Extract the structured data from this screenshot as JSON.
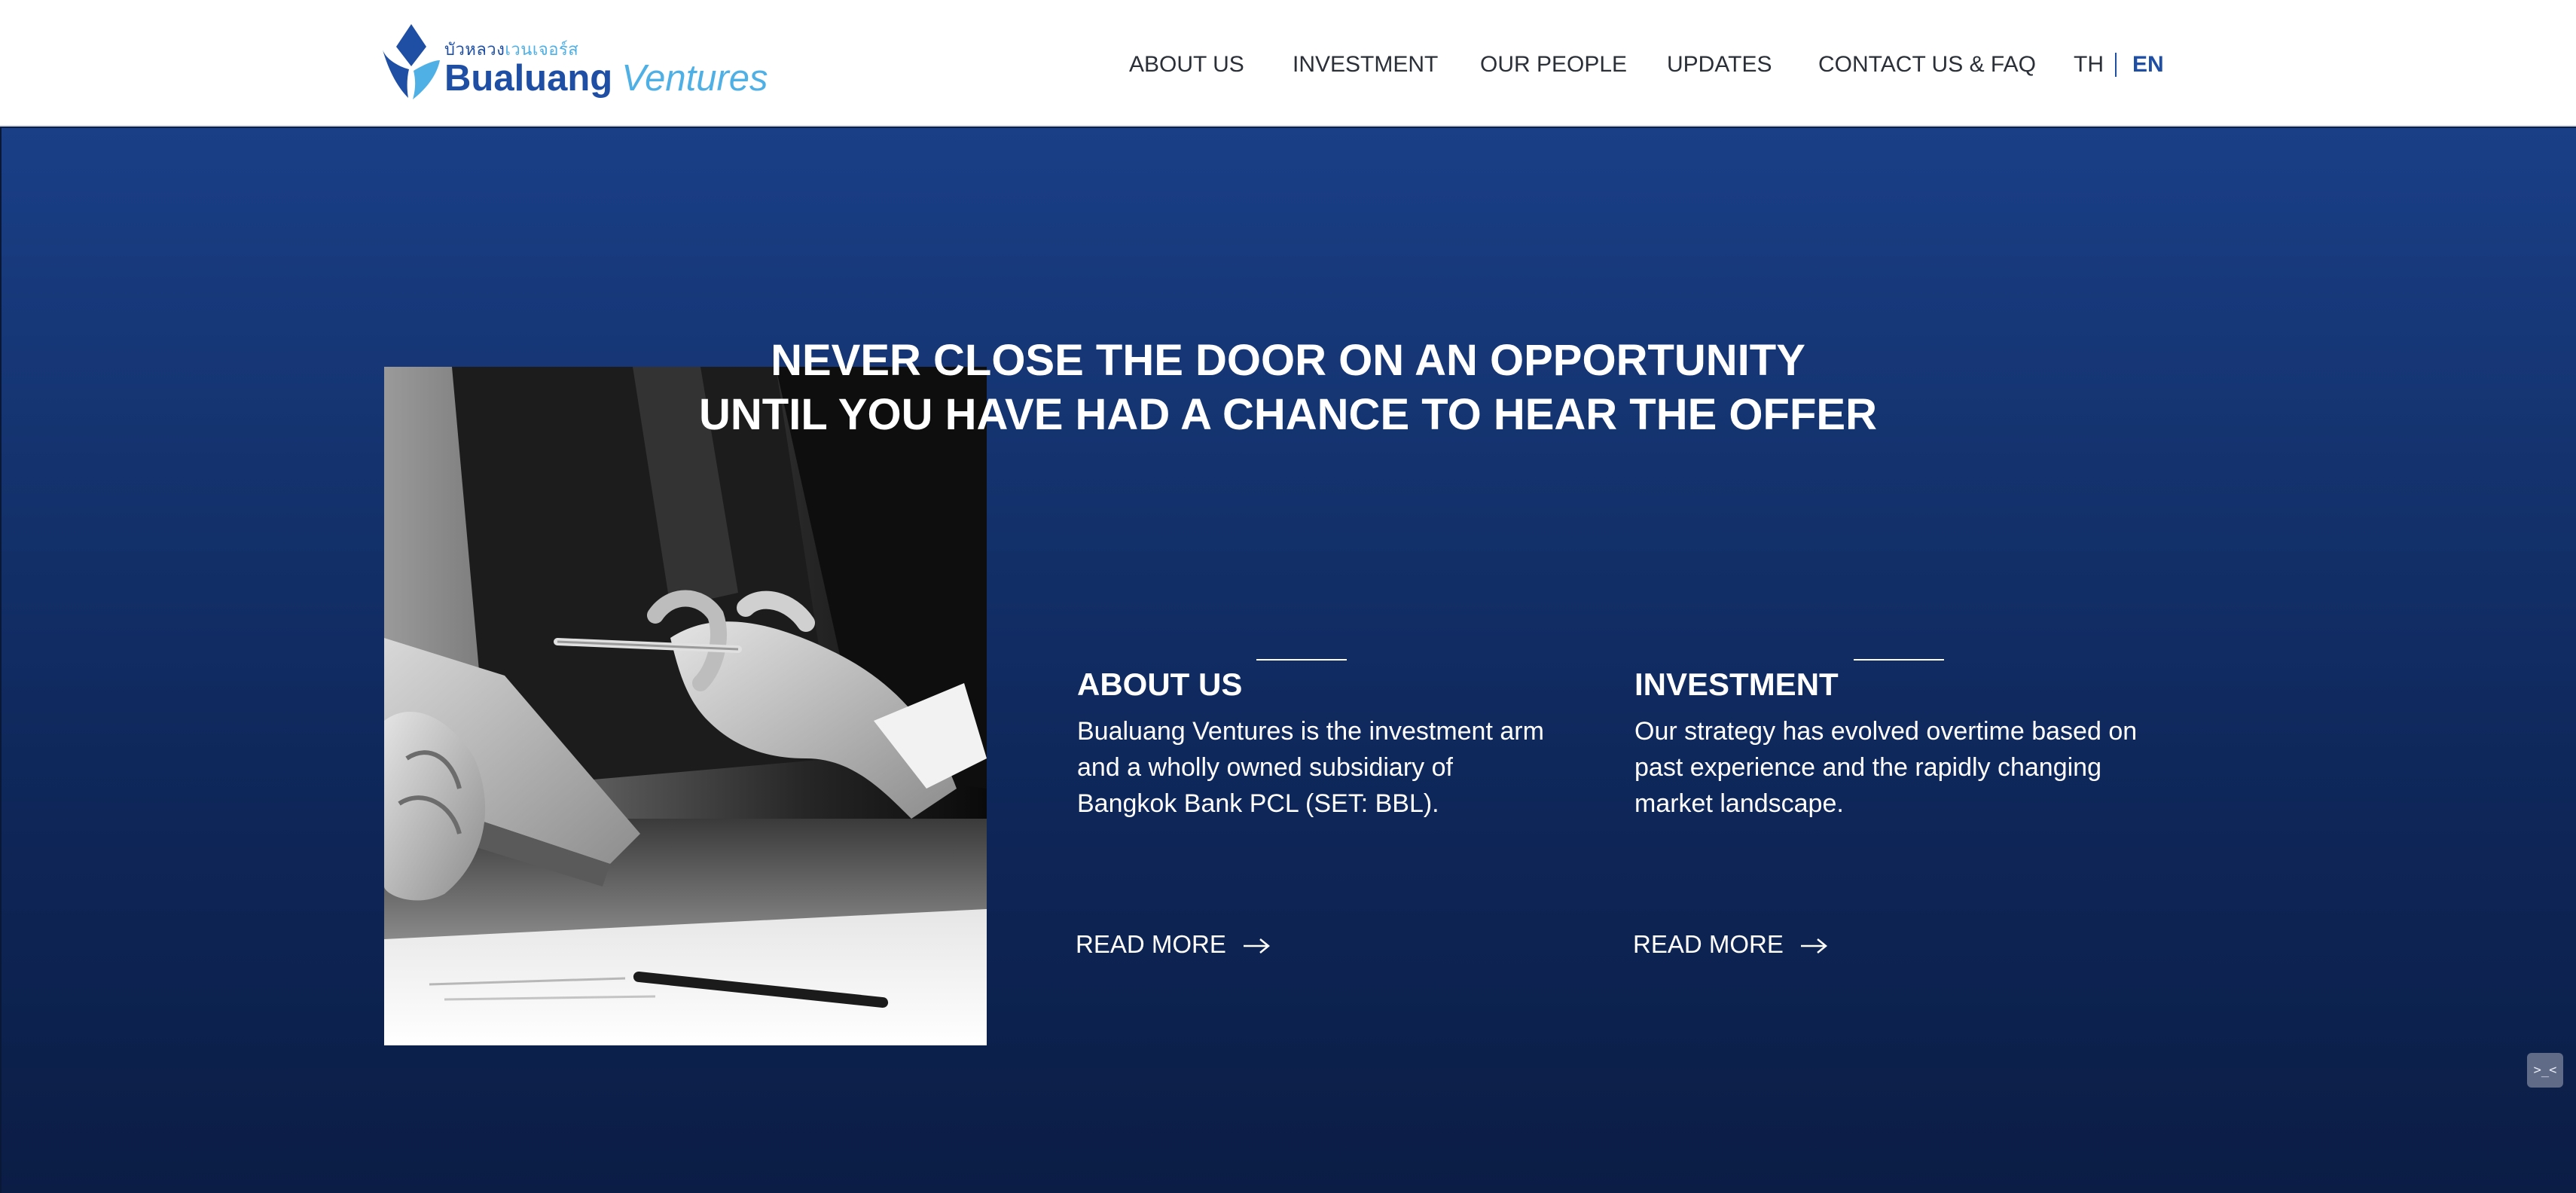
{
  "header": {
    "logo": {
      "thai_part1": "บัวหลวง",
      "thai_part2": "เวนเจอร์ส",
      "brand_bold": "Bualuang",
      "brand_italic": "Ventures"
    },
    "nav": {
      "about": "ABOUT US",
      "investment": "INVESTMENT",
      "people": "OUR PEOPLE",
      "updates": "UPDATES",
      "contact": "CONTACT US & FAQ"
    },
    "language": {
      "th": "TH",
      "en": "EN",
      "active": "EN"
    }
  },
  "hero": {
    "title_line1": "NEVER CLOSE THE DOOR ON AN OPPORTUNITY",
    "title_line2": "UNTIL YOU HAVE HAD A CHANCE TO HEAR THE OFFER",
    "about": {
      "heading": "ABOUT US",
      "body": [
        "Bualuang Ventures is the investment arm",
        "and a wholly owned subsidiary of",
        "Bangkok Bank PCL (SET: BBL)."
      ],
      "read_more": "READ MORE"
    },
    "investment": {
      "heading": "INVESTMENT",
      "body": [
        "Our strategy has evolved overtime based on",
        "past experience and the rapidly changing",
        "market landscape."
      ],
      "read_more": "READ MORE"
    }
  },
  "helper_widget": {
    "glyph": ">_<",
    "icon": "support-chat-icon"
  },
  "colors": {
    "brand_blue": "#1f4fa5",
    "brand_light_blue": "#4fb0e6",
    "hero_top": "#1a3f87",
    "hero_bottom": "#0b1d45",
    "nav_text": "#2a2f38"
  }
}
